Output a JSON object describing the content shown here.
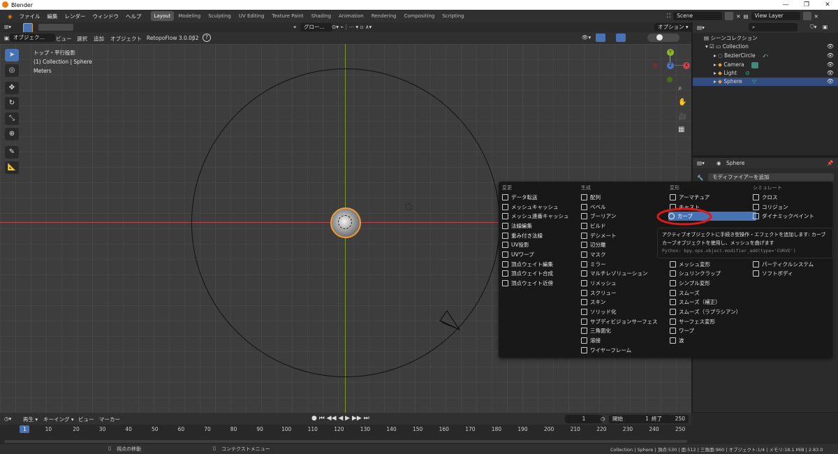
{
  "window": {
    "title": "Blender",
    "min": "—",
    "max": "❐",
    "close": "✕"
  },
  "menubar": {
    "items": [
      "ファイル",
      "編集",
      "レンダー",
      "ウィンドウ",
      "ヘルプ"
    ]
  },
  "workspaces": [
    "Layout",
    "Modeling",
    "Sculpting",
    "UV Editing",
    "Texture Paint",
    "Shading",
    "Animation",
    "Rendering",
    "Compositing",
    "Scripting"
  ],
  "active_workspace": "Layout",
  "scene": {
    "name": "Scene",
    "view_layer": "View Layer"
  },
  "tool_header": {
    "orientation": "グロー…",
    "options": "オプション ▾"
  },
  "viewport_header": {
    "mode": "オブジェク…",
    "view": "ビュー",
    "select": "選択",
    "add": "追加",
    "object": "オブジェクト",
    "addon": "RetopoFlow 3.0.0β2",
    "help": "?"
  },
  "overlay": {
    "view_name": "トップ・平行投影",
    "collection": "(1) Collection | Sphere",
    "units": "Meters"
  },
  "gizmo": {
    "y": "Y",
    "z": "Z",
    "x": "X"
  },
  "outliner": {
    "root": "シーンコレクション",
    "collection": "Collection",
    "objects": [
      {
        "name": "BezierCircle",
        "color": "#9bd4a3"
      },
      {
        "name": "Camera",
        "color": "#e8a33d"
      },
      {
        "name": "Light",
        "color": "#e8a33d"
      },
      {
        "name": "Sphere",
        "color": "#e8a33d",
        "selected": true
      }
    ]
  },
  "properties": {
    "object": "Sphere",
    "add_modifier": "モディファイアーを追加"
  },
  "modifier_menu": {
    "columns": [
      {
        "heading": "変更",
        "items": [
          "データ転送",
          "メッシュキャッシュ",
          "メッシュ連番キャッシュ",
          "法線編集",
          "重み付き法線",
          "UV投影",
          "UVワープ",
          "頂点ウェイト編集",
          "頂点ウェイト合成",
          "頂点ウェイト近傍"
        ]
      },
      {
        "heading": "生成",
        "items": [
          "配列",
          "ベベル",
          "ブーリアン",
          "ビルド",
          "デシメート",
          "辺分離",
          "マスク",
          "ミラー",
          "マルチレゾリューション",
          "リメッシュ",
          "スクリュー",
          "スキン",
          "ソリッド化",
          "サブディビジョンサーフェス",
          "三角面化",
          "溶接",
          "ワイヤーフレーム"
        ]
      },
      {
        "heading": "変形",
        "items": [
          "アーマチュア",
          "キャスト",
          "カーブ",
          "",
          "",
          "",
          "",
          "メッシュ変形",
          "シュリンクラップ",
          "シンプル変形",
          "スムーズ",
          "スムーズ（補正）",
          "スムーズ（ラプラシアン）",
          "サーフェス変形",
          "ワープ",
          "波"
        ]
      },
      {
        "heading": "シミュレート",
        "items": [
          "クロス",
          "コリジョン",
          "ダイナミックペイント",
          "",
          "",
          "",
          "",
          "パーティクルシステム",
          "ソフトボディ"
        ]
      }
    ],
    "highlighted": "カーブ",
    "highlight_ring_color": "#e01818"
  },
  "tooltip": {
    "line1": "アクティブオブジェクトに手続き型操作・エフェクトを追加します: カーブ",
    "line2": "カーブオブジェクトを使用し、メッシュを曲げます",
    "line3": "Python: bpy.ops.object.modifier_add(type='CURVE')"
  },
  "timeline": {
    "playback": "再生 ▾",
    "keying": "キーイング ▾",
    "view": "ビュー",
    "marker": "マーカー",
    "current_frame": "1",
    "start_label": "開始",
    "start": "1",
    "end_label": "終了",
    "end": "250",
    "ticks": [
      "1",
      "10",
      "20",
      "30",
      "40",
      "50",
      "60",
      "70",
      "80",
      "90",
      "100",
      "110",
      "120",
      "130",
      "140",
      "150",
      "160",
      "170",
      "180",
      "190",
      "200",
      "210",
      "220",
      "230",
      "240",
      "250"
    ]
  },
  "statusbar": {
    "left1": "視点の移動",
    "left2": "コンテクストメニュー",
    "right": "Collection | Sphere | 頂点:530 | 面:512 | 三角面:960 | オブジェクト:1/4 | メモリ:18.1 MiB | 2.83.0"
  }
}
